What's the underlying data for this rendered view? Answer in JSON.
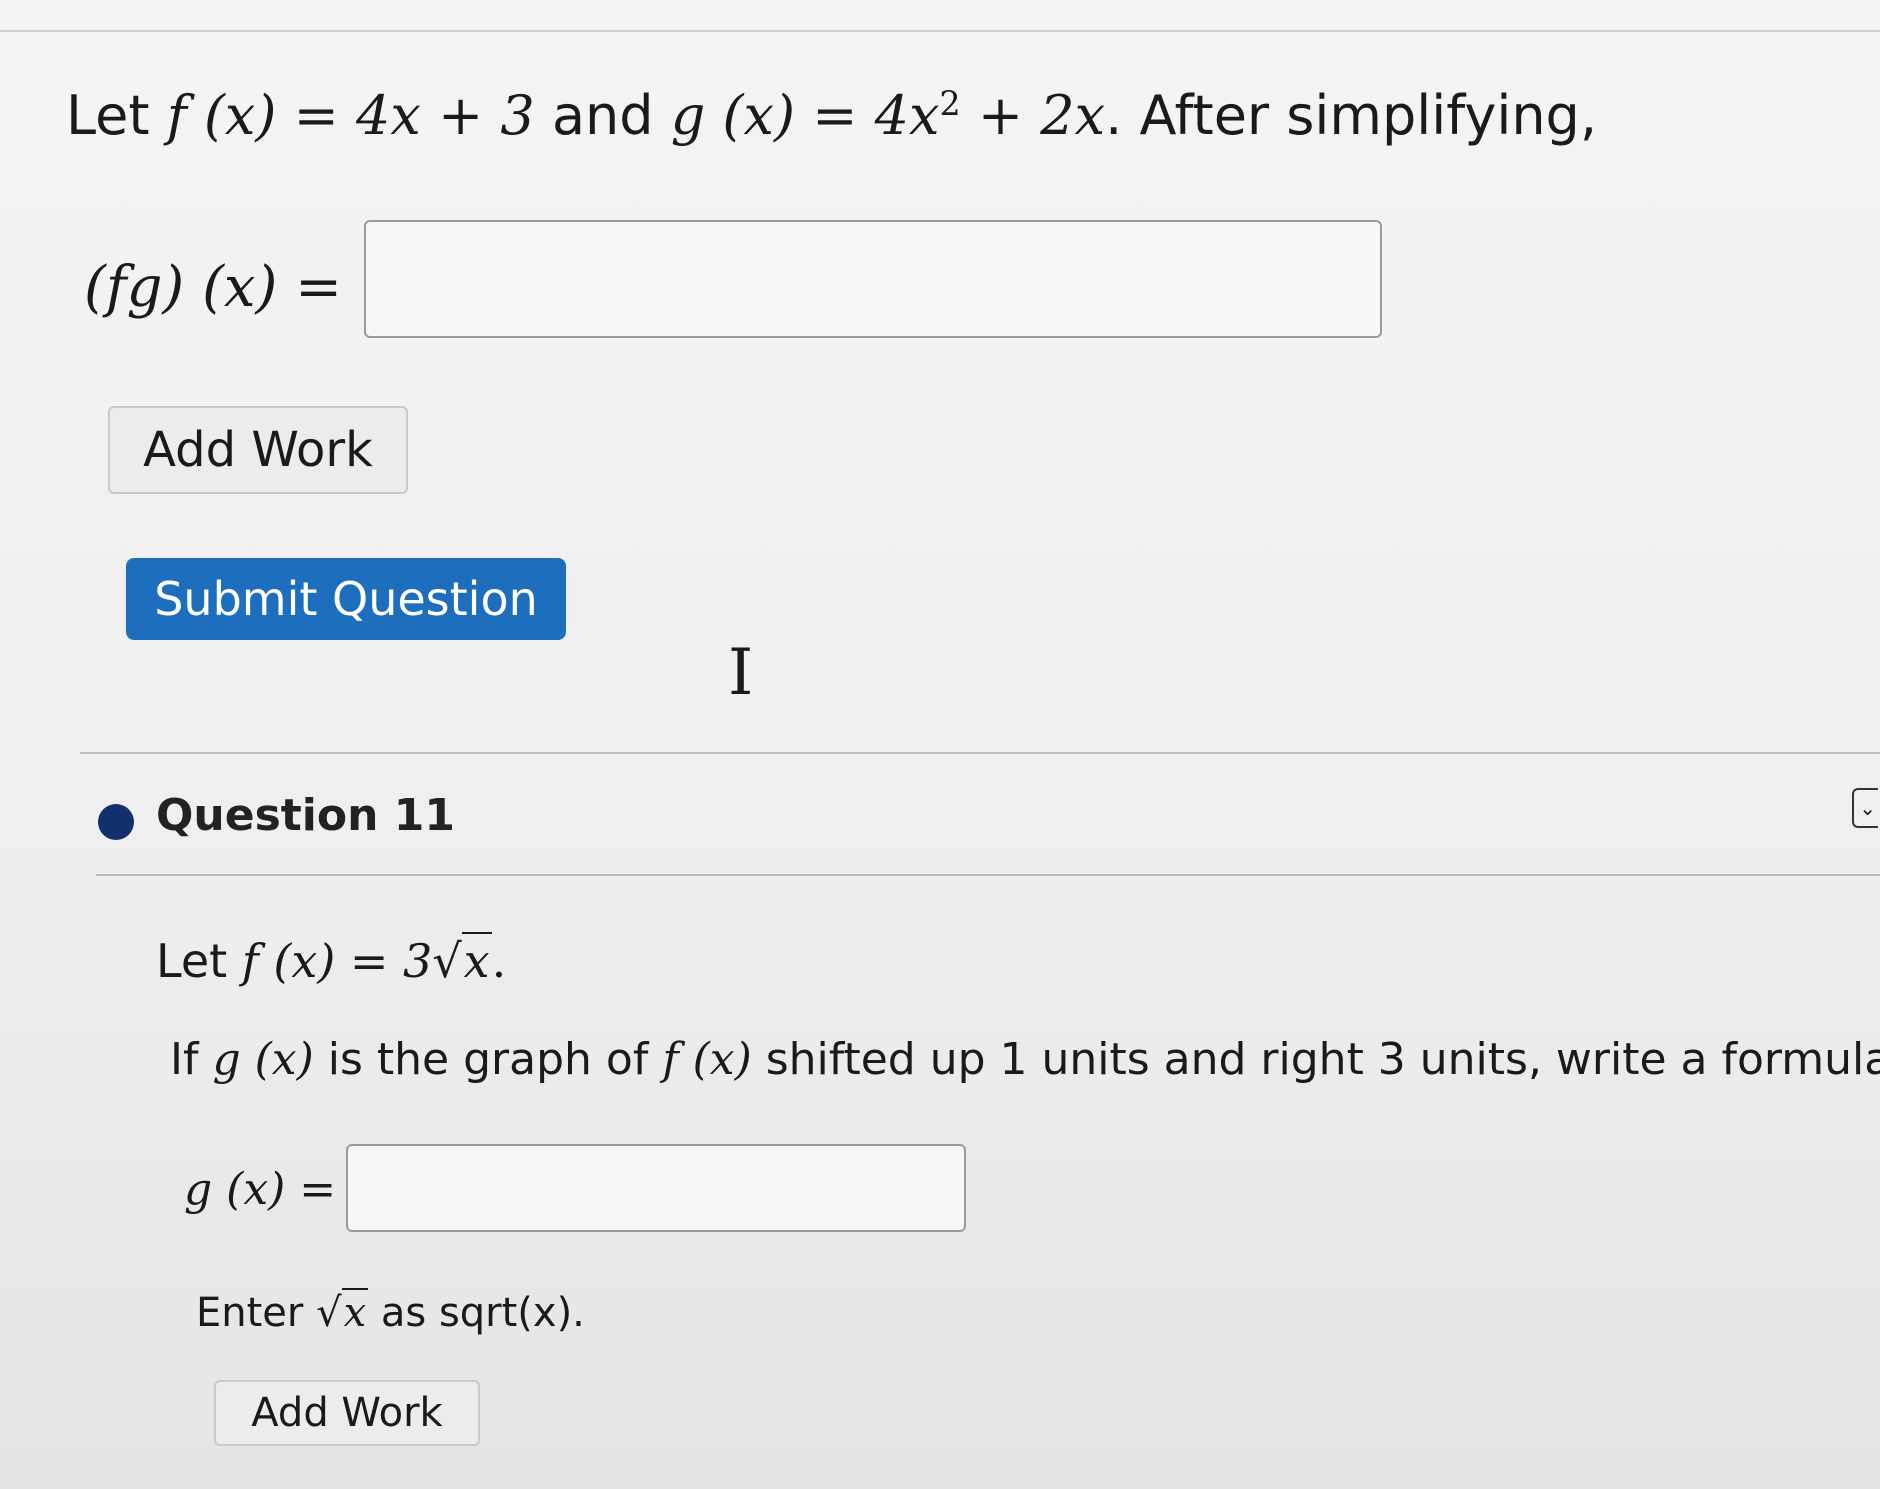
{
  "question10": {
    "stem_prefix": "Let",
    "f_def": "f (x) = 4x + 3",
    "stem_and": "and",
    "g_def_a": "g (x) = 4x",
    "g_exp": "2",
    "g_def_b": " + 2x",
    "stem_suffix": ". After simplifying,",
    "answer_label": "(fg) (x) =",
    "answer_value": "",
    "add_work_label": "Add Work",
    "submit_label": "Submit Question"
  },
  "question11": {
    "title": "Question 11",
    "let_prefix": "Let",
    "f_def_a": "f (x) = 3",
    "f_def_rad": "x",
    "f_def_end": ".",
    "stem_if": "If",
    "stem_g": "g (x)",
    "stem_mid": "is the graph of",
    "stem_f": "f (x)",
    "stem_rest": "shifted up 1 units and right 3 units, write a formula",
    "answer_label": "g (x) =",
    "answer_value": "",
    "hint_prefix": "Enter",
    "hint_rad": "x",
    "hint_suffix": "as sqrt(x).",
    "add_work_label": "Add Work"
  },
  "icons": {
    "text_cursor": "I-beam cursor",
    "status_dot": "filled circle",
    "menu": "chevron-down"
  },
  "colors": {
    "primary_button": "#1d6fbd",
    "status_dot": "#12306e"
  }
}
